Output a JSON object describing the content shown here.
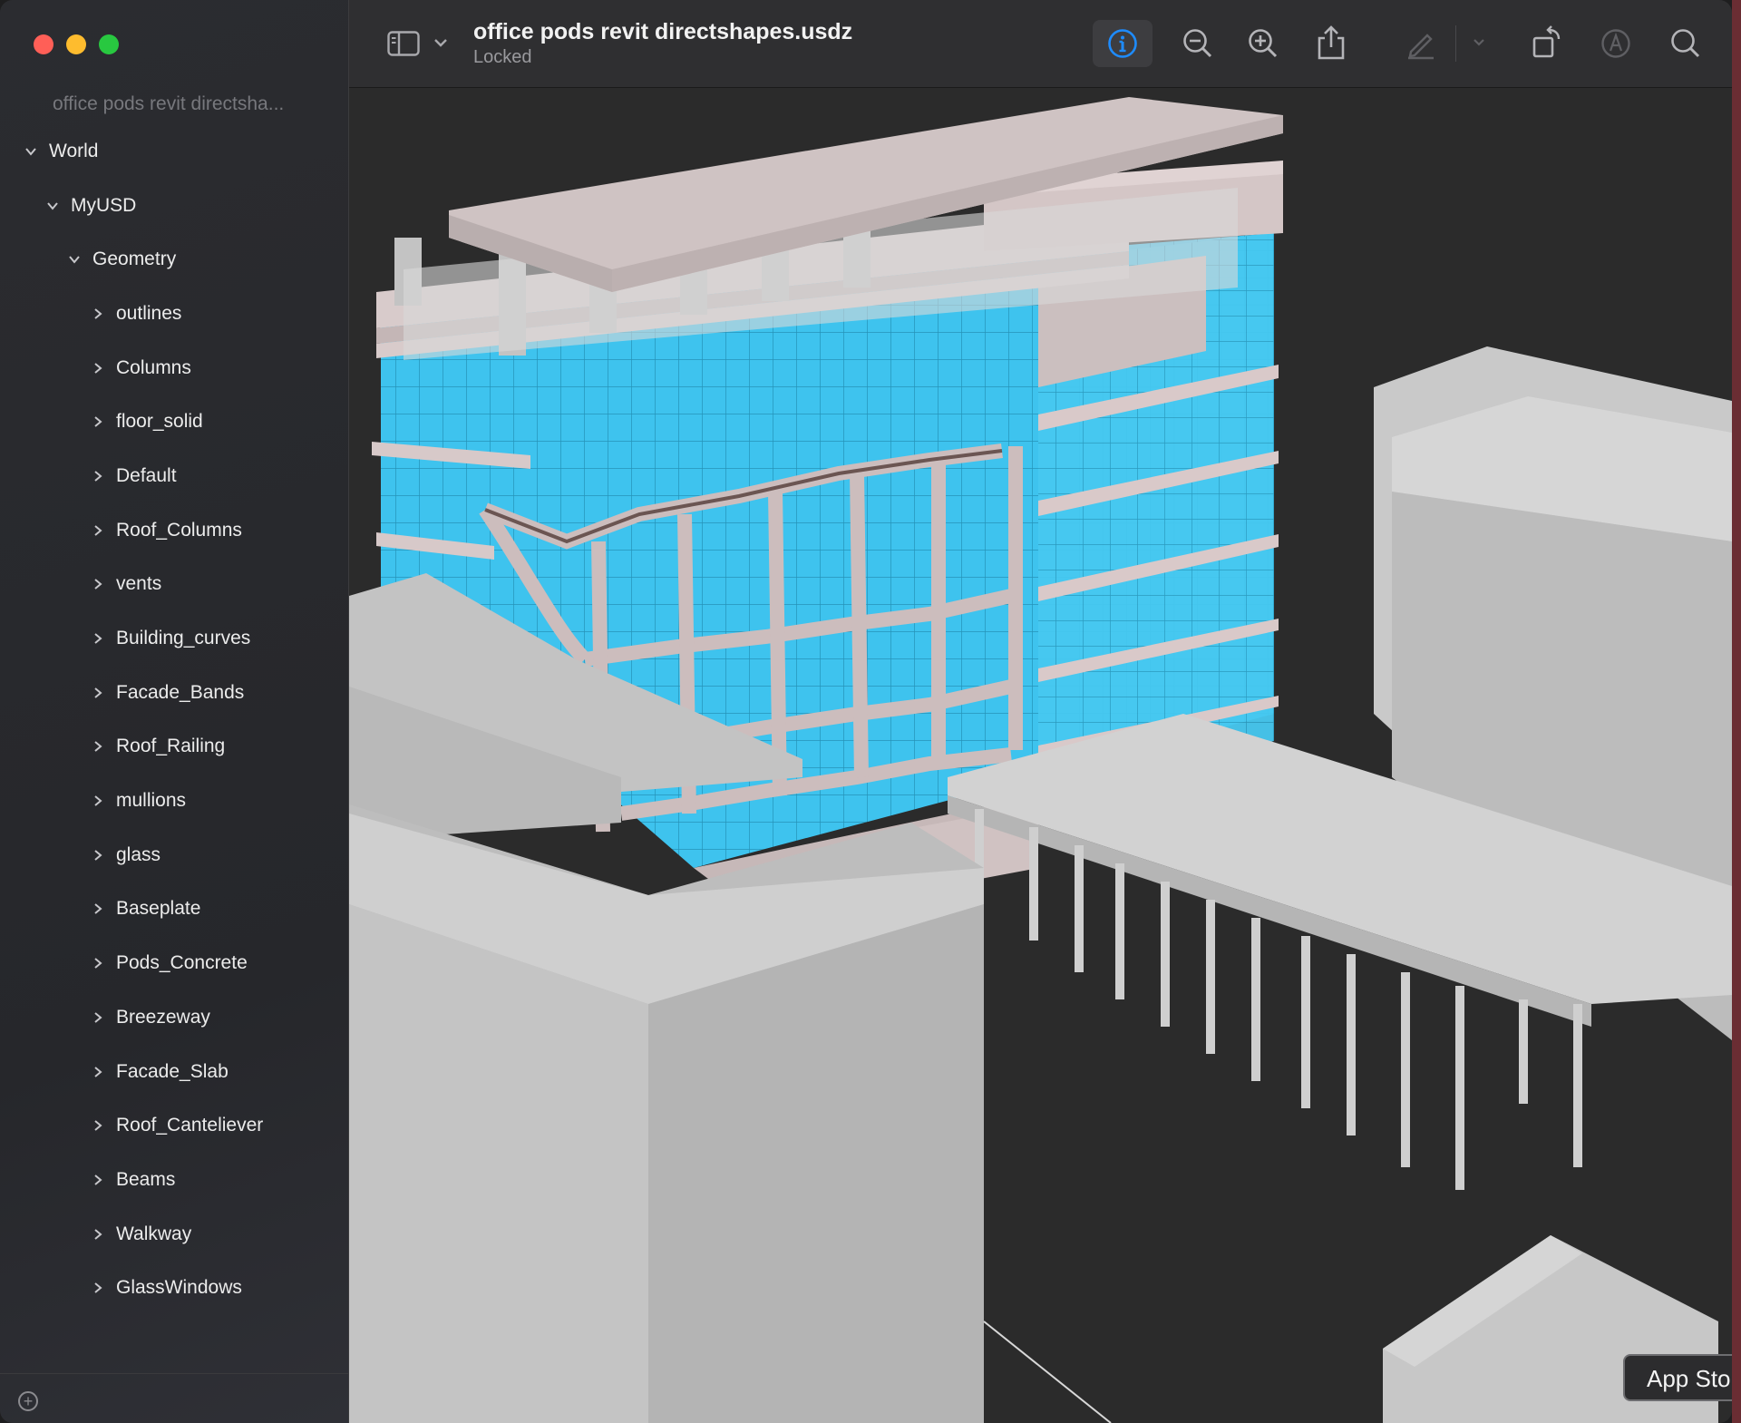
{
  "window": {
    "traffic_lights": [
      "#ff5f57",
      "#febc2e",
      "#28c840"
    ]
  },
  "sidebar": {
    "title": "office pods revit directsha...",
    "tree": [
      {
        "label": "World",
        "level": 0,
        "expanded": true
      },
      {
        "label": "MyUSD",
        "level": 1,
        "expanded": true
      },
      {
        "label": "Geometry",
        "level": 2,
        "expanded": true
      },
      {
        "label": "outlines",
        "level": 3,
        "expanded": false
      },
      {
        "label": "Columns",
        "level": 3,
        "expanded": false
      },
      {
        "label": "floor_solid",
        "level": 3,
        "expanded": false
      },
      {
        "label": "Default",
        "level": 3,
        "expanded": false
      },
      {
        "label": "Roof_Columns",
        "level": 3,
        "expanded": false
      },
      {
        "label": "vents",
        "level": 3,
        "expanded": false
      },
      {
        "label": "Building_curves",
        "level": 3,
        "expanded": false
      },
      {
        "label": "Facade_Bands",
        "level": 3,
        "expanded": false
      },
      {
        "label": "Roof_Railing",
        "level": 3,
        "expanded": false
      },
      {
        "label": "mullions",
        "level": 3,
        "expanded": false
      },
      {
        "label": "glass",
        "level": 3,
        "expanded": false
      },
      {
        "label": "Baseplate",
        "level": 3,
        "expanded": false
      },
      {
        "label": "Pods_Concrete",
        "level": 3,
        "expanded": false
      },
      {
        "label": "Breezeway",
        "level": 3,
        "expanded": false
      },
      {
        "label": "Facade_Slab",
        "level": 3,
        "expanded": false
      },
      {
        "label": "Roof_Canteliever",
        "level": 3,
        "expanded": false
      },
      {
        "label": "Beams",
        "level": 3,
        "expanded": false
      },
      {
        "label": "Walkway",
        "level": 3,
        "expanded": false
      },
      {
        "label": "GlassWindows",
        "level": 3,
        "expanded": false
      }
    ],
    "add_icon": "plus-circle-icon"
  },
  "toolbar": {
    "doc_title": "office pods revit directshapes.usdz",
    "doc_status": "Locked",
    "icons": [
      "sidebar-toggle-icon",
      "chevron-down-icon",
      "info-icon",
      "zoom-out-icon",
      "zoom-in-icon",
      "share-icon",
      "markup-pen-icon",
      "chevron-down-icon",
      "rotate-icon",
      "annotate-icon",
      "search-icon"
    ],
    "accent": "#1e8cff"
  },
  "viewport": {
    "background": "#2b2b2b",
    "glass_color": "#3ec3ee",
    "concrete_color": "#c8c8c8",
    "slab_color": "#cdbfbf"
  },
  "tooltip": {
    "text": "App Stor"
  }
}
